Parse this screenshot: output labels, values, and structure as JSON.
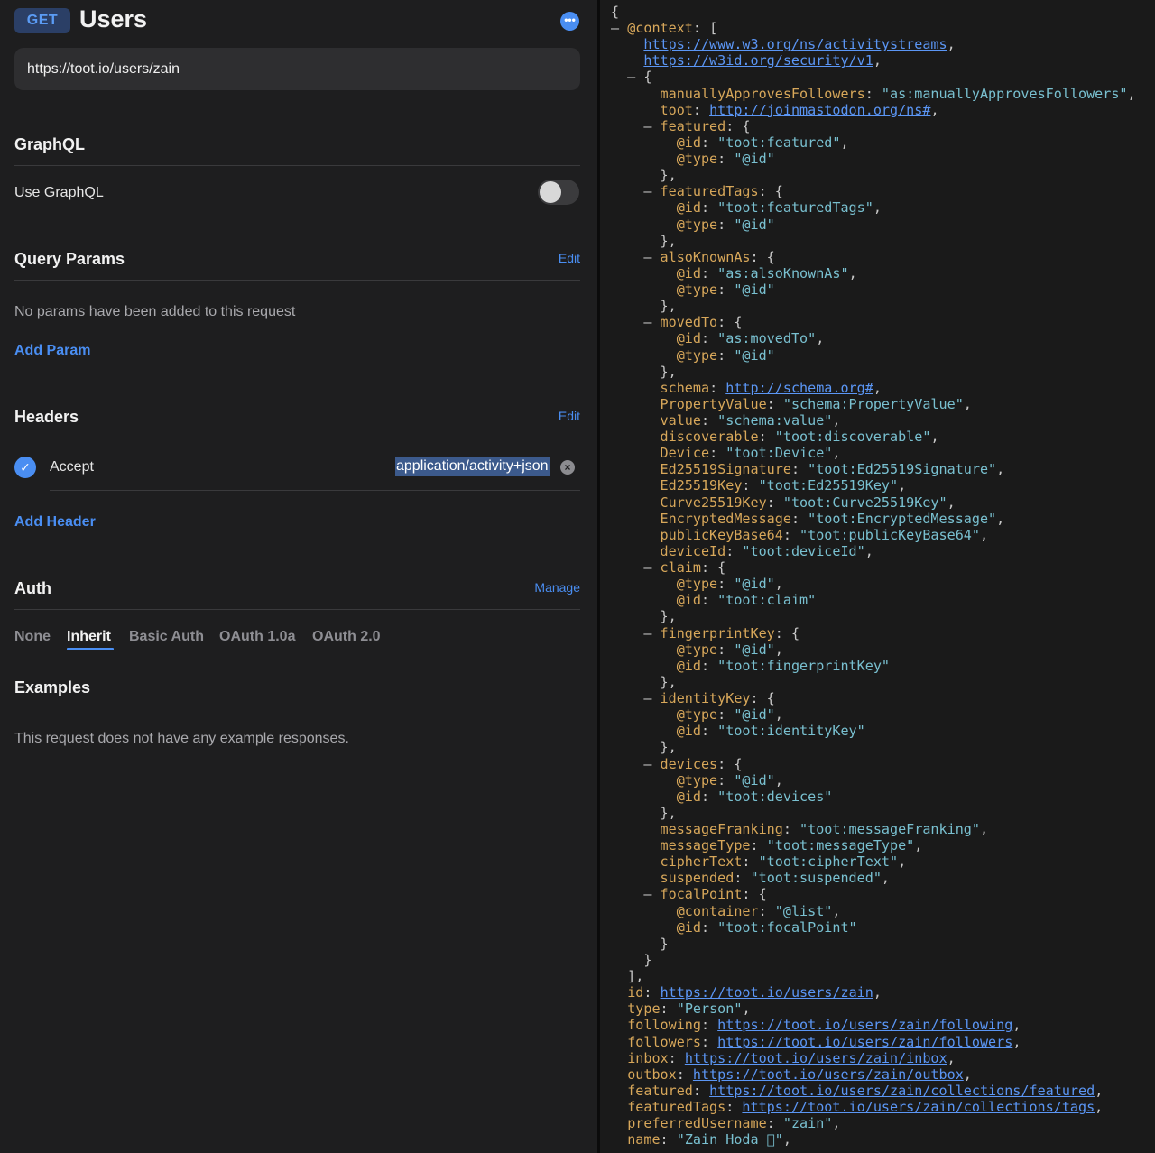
{
  "request": {
    "method": "GET",
    "title": "Users",
    "more_icon": "ellipsis-icon",
    "url": "https://toot.io/users/zain"
  },
  "graphql": {
    "title": "GraphQL",
    "toggle_label": "Use GraphQL",
    "enabled": false
  },
  "query_params": {
    "title": "Query Params",
    "edit_label": "Edit",
    "empty_text": "No params have been added to this request",
    "add_label": "Add Param"
  },
  "headers": {
    "title": "Headers",
    "edit_label": "Edit",
    "items": [
      {
        "enabled": true,
        "key": "Accept",
        "value": "application/activity+json"
      }
    ],
    "add_label": "Add Header"
  },
  "auth": {
    "title": "Auth",
    "manage_label": "Manage",
    "tabs": [
      "None",
      "Inherit",
      "Basic Auth",
      "OAuth 1.0a",
      "OAuth 2.0"
    ],
    "active_tab": "Inherit"
  },
  "examples": {
    "title": "Examples",
    "empty_text": "This request does not have any example responses."
  },
  "colors": {
    "accent": "#4a8ef2",
    "json_key": "#d7a75a",
    "json_string": "#79c0d0",
    "json_link": "#5b96f5"
  },
  "json_lines": [
    [
      [
        "p",
        "{"
      ]
    ],
    [
      [
        "tog",
        "– "
      ],
      [
        "k",
        "@context"
      ],
      [
        "p",
        ": ["
      ]
    ],
    [
      [
        "p",
        "    "
      ],
      [
        "u",
        "https://www.w3.org/ns/activitystreams"
      ],
      [
        "p",
        ","
      ]
    ],
    [
      [
        "p",
        "    "
      ],
      [
        "u",
        "https://w3id.org/security/v1"
      ],
      [
        "p",
        ","
      ]
    ],
    [
      [
        "tog",
        "  – "
      ],
      [
        "p",
        "{"
      ]
    ],
    [
      [
        "p",
        "      "
      ],
      [
        "k",
        "manuallyApprovesFollowers"
      ],
      [
        "p",
        ": "
      ],
      [
        "s",
        "\"as:manuallyApprovesFollowers\""
      ],
      [
        "p",
        ","
      ]
    ],
    [
      [
        "p",
        "      "
      ],
      [
        "k",
        "toot"
      ],
      [
        "p",
        ": "
      ],
      [
        "u",
        "http://joinmastodon.org/ns#"
      ],
      [
        "p",
        ","
      ]
    ],
    [
      [
        "tog",
        "    – "
      ],
      [
        "k",
        "featured"
      ],
      [
        "p",
        ": {"
      ]
    ],
    [
      [
        "p",
        "        "
      ],
      [
        "k",
        "@id"
      ],
      [
        "p",
        ": "
      ],
      [
        "s",
        "\"toot:featured\""
      ],
      [
        "p",
        ","
      ]
    ],
    [
      [
        "p",
        "        "
      ],
      [
        "k",
        "@type"
      ],
      [
        "p",
        ": "
      ],
      [
        "s",
        "\"@id\""
      ]
    ],
    [
      [
        "p",
        "      },"
      ]
    ],
    [
      [
        "tog",
        "    – "
      ],
      [
        "k",
        "featuredTags"
      ],
      [
        "p",
        ": {"
      ]
    ],
    [
      [
        "p",
        "        "
      ],
      [
        "k",
        "@id"
      ],
      [
        "p",
        ": "
      ],
      [
        "s",
        "\"toot:featuredTags\""
      ],
      [
        "p",
        ","
      ]
    ],
    [
      [
        "p",
        "        "
      ],
      [
        "k",
        "@type"
      ],
      [
        "p",
        ": "
      ],
      [
        "s",
        "\"@id\""
      ]
    ],
    [
      [
        "p",
        "      },"
      ]
    ],
    [
      [
        "tog",
        "    – "
      ],
      [
        "k",
        "alsoKnownAs"
      ],
      [
        "p",
        ": {"
      ]
    ],
    [
      [
        "p",
        "        "
      ],
      [
        "k",
        "@id"
      ],
      [
        "p",
        ": "
      ],
      [
        "s",
        "\"as:alsoKnownAs\""
      ],
      [
        "p",
        ","
      ]
    ],
    [
      [
        "p",
        "        "
      ],
      [
        "k",
        "@type"
      ],
      [
        "p",
        ": "
      ],
      [
        "s",
        "\"@id\""
      ]
    ],
    [
      [
        "p",
        "      },"
      ]
    ],
    [
      [
        "tog",
        "    – "
      ],
      [
        "k",
        "movedTo"
      ],
      [
        "p",
        ": {"
      ]
    ],
    [
      [
        "p",
        "        "
      ],
      [
        "k",
        "@id"
      ],
      [
        "p",
        ": "
      ],
      [
        "s",
        "\"as:movedTo\""
      ],
      [
        "p",
        ","
      ]
    ],
    [
      [
        "p",
        "        "
      ],
      [
        "k",
        "@type"
      ],
      [
        "p",
        ": "
      ],
      [
        "s",
        "\"@id\""
      ]
    ],
    [
      [
        "p",
        "      },"
      ]
    ],
    [
      [
        "p",
        "      "
      ],
      [
        "k",
        "schema"
      ],
      [
        "p",
        ": "
      ],
      [
        "u",
        "http://schema.org#"
      ],
      [
        "p",
        ","
      ]
    ],
    [
      [
        "p",
        "      "
      ],
      [
        "k",
        "PropertyValue"
      ],
      [
        "p",
        ": "
      ],
      [
        "s",
        "\"schema:PropertyValue\""
      ],
      [
        "p",
        ","
      ]
    ],
    [
      [
        "p",
        "      "
      ],
      [
        "k",
        "value"
      ],
      [
        "p",
        ": "
      ],
      [
        "s",
        "\"schema:value\""
      ],
      [
        "p",
        ","
      ]
    ],
    [
      [
        "p",
        "      "
      ],
      [
        "k",
        "discoverable"
      ],
      [
        "p",
        ": "
      ],
      [
        "s",
        "\"toot:discoverable\""
      ],
      [
        "p",
        ","
      ]
    ],
    [
      [
        "p",
        "      "
      ],
      [
        "k",
        "Device"
      ],
      [
        "p",
        ": "
      ],
      [
        "s",
        "\"toot:Device\""
      ],
      [
        "p",
        ","
      ]
    ],
    [
      [
        "p",
        "      "
      ],
      [
        "k",
        "Ed25519Signature"
      ],
      [
        "p",
        ": "
      ],
      [
        "s",
        "\"toot:Ed25519Signature\""
      ],
      [
        "p",
        ","
      ]
    ],
    [
      [
        "p",
        "      "
      ],
      [
        "k",
        "Ed25519Key"
      ],
      [
        "p",
        ": "
      ],
      [
        "s",
        "\"toot:Ed25519Key\""
      ],
      [
        "p",
        ","
      ]
    ],
    [
      [
        "p",
        "      "
      ],
      [
        "k",
        "Curve25519Key"
      ],
      [
        "p",
        ": "
      ],
      [
        "s",
        "\"toot:Curve25519Key\""
      ],
      [
        "p",
        ","
      ]
    ],
    [
      [
        "p",
        "      "
      ],
      [
        "k",
        "EncryptedMessage"
      ],
      [
        "p",
        ": "
      ],
      [
        "s",
        "\"toot:EncryptedMessage\""
      ],
      [
        "p",
        ","
      ]
    ],
    [
      [
        "p",
        "      "
      ],
      [
        "k",
        "publicKeyBase64"
      ],
      [
        "p",
        ": "
      ],
      [
        "s",
        "\"toot:publicKeyBase64\""
      ],
      [
        "p",
        ","
      ]
    ],
    [
      [
        "p",
        "      "
      ],
      [
        "k",
        "deviceId"
      ],
      [
        "p",
        ": "
      ],
      [
        "s",
        "\"toot:deviceId\""
      ],
      [
        "p",
        ","
      ]
    ],
    [
      [
        "tog",
        "    – "
      ],
      [
        "k",
        "claim"
      ],
      [
        "p",
        ": {"
      ]
    ],
    [
      [
        "p",
        "        "
      ],
      [
        "k",
        "@type"
      ],
      [
        "p",
        ": "
      ],
      [
        "s",
        "\"@id\""
      ],
      [
        "p",
        ","
      ]
    ],
    [
      [
        "p",
        "        "
      ],
      [
        "k",
        "@id"
      ],
      [
        "p",
        ": "
      ],
      [
        "s",
        "\"toot:claim\""
      ]
    ],
    [
      [
        "p",
        "      },"
      ]
    ],
    [
      [
        "tog",
        "    – "
      ],
      [
        "k",
        "fingerprintKey"
      ],
      [
        "p",
        ": {"
      ]
    ],
    [
      [
        "p",
        "        "
      ],
      [
        "k",
        "@type"
      ],
      [
        "p",
        ": "
      ],
      [
        "s",
        "\"@id\""
      ],
      [
        "p",
        ","
      ]
    ],
    [
      [
        "p",
        "        "
      ],
      [
        "k",
        "@id"
      ],
      [
        "p",
        ": "
      ],
      [
        "s",
        "\"toot:fingerprintKey\""
      ]
    ],
    [
      [
        "p",
        "      },"
      ]
    ],
    [
      [
        "tog",
        "    – "
      ],
      [
        "k",
        "identityKey"
      ],
      [
        "p",
        ": {"
      ]
    ],
    [
      [
        "p",
        "        "
      ],
      [
        "k",
        "@type"
      ],
      [
        "p",
        ": "
      ],
      [
        "s",
        "\"@id\""
      ],
      [
        "p",
        ","
      ]
    ],
    [
      [
        "p",
        "        "
      ],
      [
        "k",
        "@id"
      ],
      [
        "p",
        ": "
      ],
      [
        "s",
        "\"toot:identityKey\""
      ]
    ],
    [
      [
        "p",
        "      },"
      ]
    ],
    [
      [
        "tog",
        "    – "
      ],
      [
        "k",
        "devices"
      ],
      [
        "p",
        ": {"
      ]
    ],
    [
      [
        "p",
        "        "
      ],
      [
        "k",
        "@type"
      ],
      [
        "p",
        ": "
      ],
      [
        "s",
        "\"@id\""
      ],
      [
        "p",
        ","
      ]
    ],
    [
      [
        "p",
        "        "
      ],
      [
        "k",
        "@id"
      ],
      [
        "p",
        ": "
      ],
      [
        "s",
        "\"toot:devices\""
      ]
    ],
    [
      [
        "p",
        "      },"
      ]
    ],
    [
      [
        "p",
        "      "
      ],
      [
        "k",
        "messageFranking"
      ],
      [
        "p",
        ": "
      ],
      [
        "s",
        "\"toot:messageFranking\""
      ],
      [
        "p",
        ","
      ]
    ],
    [
      [
        "p",
        "      "
      ],
      [
        "k",
        "messageType"
      ],
      [
        "p",
        ": "
      ],
      [
        "s",
        "\"toot:messageType\""
      ],
      [
        "p",
        ","
      ]
    ],
    [
      [
        "p",
        "      "
      ],
      [
        "k",
        "cipherText"
      ],
      [
        "p",
        ": "
      ],
      [
        "s",
        "\"toot:cipherText\""
      ],
      [
        "p",
        ","
      ]
    ],
    [
      [
        "p",
        "      "
      ],
      [
        "k",
        "suspended"
      ],
      [
        "p",
        ": "
      ],
      [
        "s",
        "\"toot:suspended\""
      ],
      [
        "p",
        ","
      ]
    ],
    [
      [
        "tog",
        "    – "
      ],
      [
        "k",
        "focalPoint"
      ],
      [
        "p",
        ": {"
      ]
    ],
    [
      [
        "p",
        "        "
      ],
      [
        "k",
        "@container"
      ],
      [
        "p",
        ": "
      ],
      [
        "s",
        "\"@list\""
      ],
      [
        "p",
        ","
      ]
    ],
    [
      [
        "p",
        "        "
      ],
      [
        "k",
        "@id"
      ],
      [
        "p",
        ": "
      ],
      [
        "s",
        "\"toot:focalPoint\""
      ]
    ],
    [
      [
        "p",
        "      }"
      ]
    ],
    [
      [
        "p",
        "    }"
      ]
    ],
    [
      [
        "p",
        "  ],"
      ]
    ],
    [
      [
        "p",
        "  "
      ],
      [
        "k",
        "id"
      ],
      [
        "p",
        ": "
      ],
      [
        "u",
        "https://toot.io/users/zain"
      ],
      [
        "p",
        ","
      ]
    ],
    [
      [
        "p",
        "  "
      ],
      [
        "k",
        "type"
      ],
      [
        "p",
        ": "
      ],
      [
        "s",
        "\"Person\""
      ],
      [
        "p",
        ","
      ]
    ],
    [
      [
        "p",
        "  "
      ],
      [
        "k",
        "following"
      ],
      [
        "p",
        ": "
      ],
      [
        "u",
        "https://toot.io/users/zain/following"
      ],
      [
        "p",
        ","
      ]
    ],
    [
      [
        "p",
        "  "
      ],
      [
        "k",
        "followers"
      ],
      [
        "p",
        ": "
      ],
      [
        "u",
        "https://toot.io/users/zain/followers"
      ],
      [
        "p",
        ","
      ]
    ],
    [
      [
        "p",
        "  "
      ],
      [
        "k",
        "inbox"
      ],
      [
        "p",
        ": "
      ],
      [
        "u",
        "https://toot.io/users/zain/inbox"
      ],
      [
        "p",
        ","
      ]
    ],
    [
      [
        "p",
        "  "
      ],
      [
        "k",
        "outbox"
      ],
      [
        "p",
        ": "
      ],
      [
        "u",
        "https://toot.io/users/zain/outbox"
      ],
      [
        "p",
        ","
      ]
    ],
    [
      [
        "p",
        "  "
      ],
      [
        "k",
        "featured"
      ],
      [
        "p",
        ": "
      ],
      [
        "u",
        "https://toot.io/users/zain/collections/featured"
      ],
      [
        "p",
        ","
      ]
    ],
    [
      [
        "p",
        "  "
      ],
      [
        "k",
        "featuredTags"
      ],
      [
        "p",
        ": "
      ],
      [
        "u",
        "https://toot.io/users/zain/collections/tags"
      ],
      [
        "p",
        ","
      ]
    ],
    [
      [
        "p",
        "  "
      ],
      [
        "k",
        "preferredUsername"
      ],
      [
        "p",
        ": "
      ],
      [
        "s",
        "\"zain\""
      ],
      [
        "p",
        ","
      ]
    ],
    [
      [
        "p",
        "  "
      ],
      [
        "k",
        "name"
      ],
      [
        "p",
        ": "
      ],
      [
        "s",
        "\"Zain Hoda \""
      ],
      [
        "p",
        ","
      ]
    ]
  ]
}
